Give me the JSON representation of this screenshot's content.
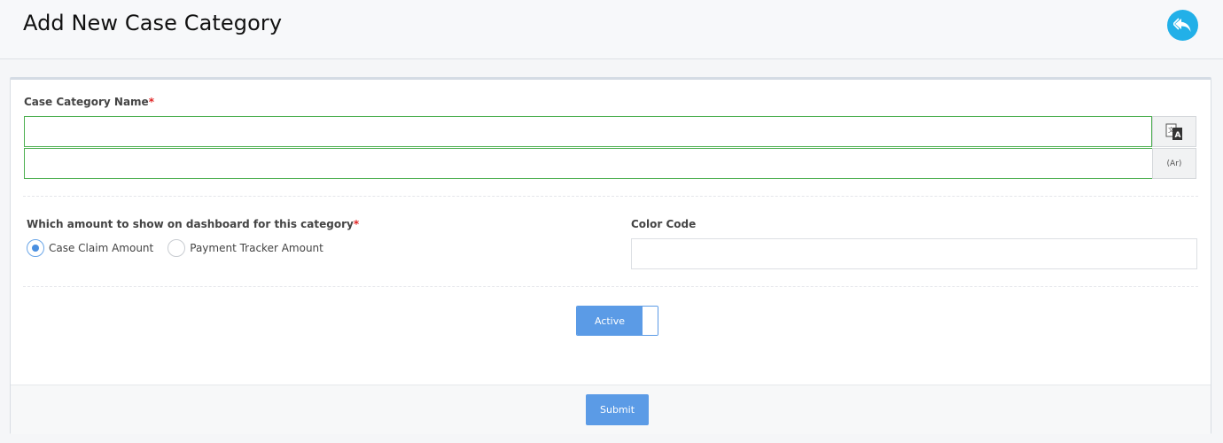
{
  "header": {
    "title": "Add New Case Category",
    "back_icon": "reply-arrow-icon",
    "accent": "#22b0e8"
  },
  "form": {
    "name_label": "Case Category Name",
    "required_mark": "*",
    "name_value": "",
    "name_ar_value": "",
    "translate_icon": "translate-icon",
    "ar_addon_label": "(Ar)",
    "amount_label": "Which amount to show on dashboard for this category",
    "amount_options": [
      {
        "label": "Case Claim Amount",
        "checked": true
      },
      {
        "label": "Payment Tracker Amount",
        "checked": false
      }
    ],
    "color_label": "Color Code",
    "color_value": "",
    "active_toggle": {
      "label": "Active",
      "on": true
    },
    "submit_label": "Submit"
  },
  "colors": {
    "primary_button": "#5b9be6",
    "valid_border": "#4caf50",
    "required": "#e02424"
  }
}
